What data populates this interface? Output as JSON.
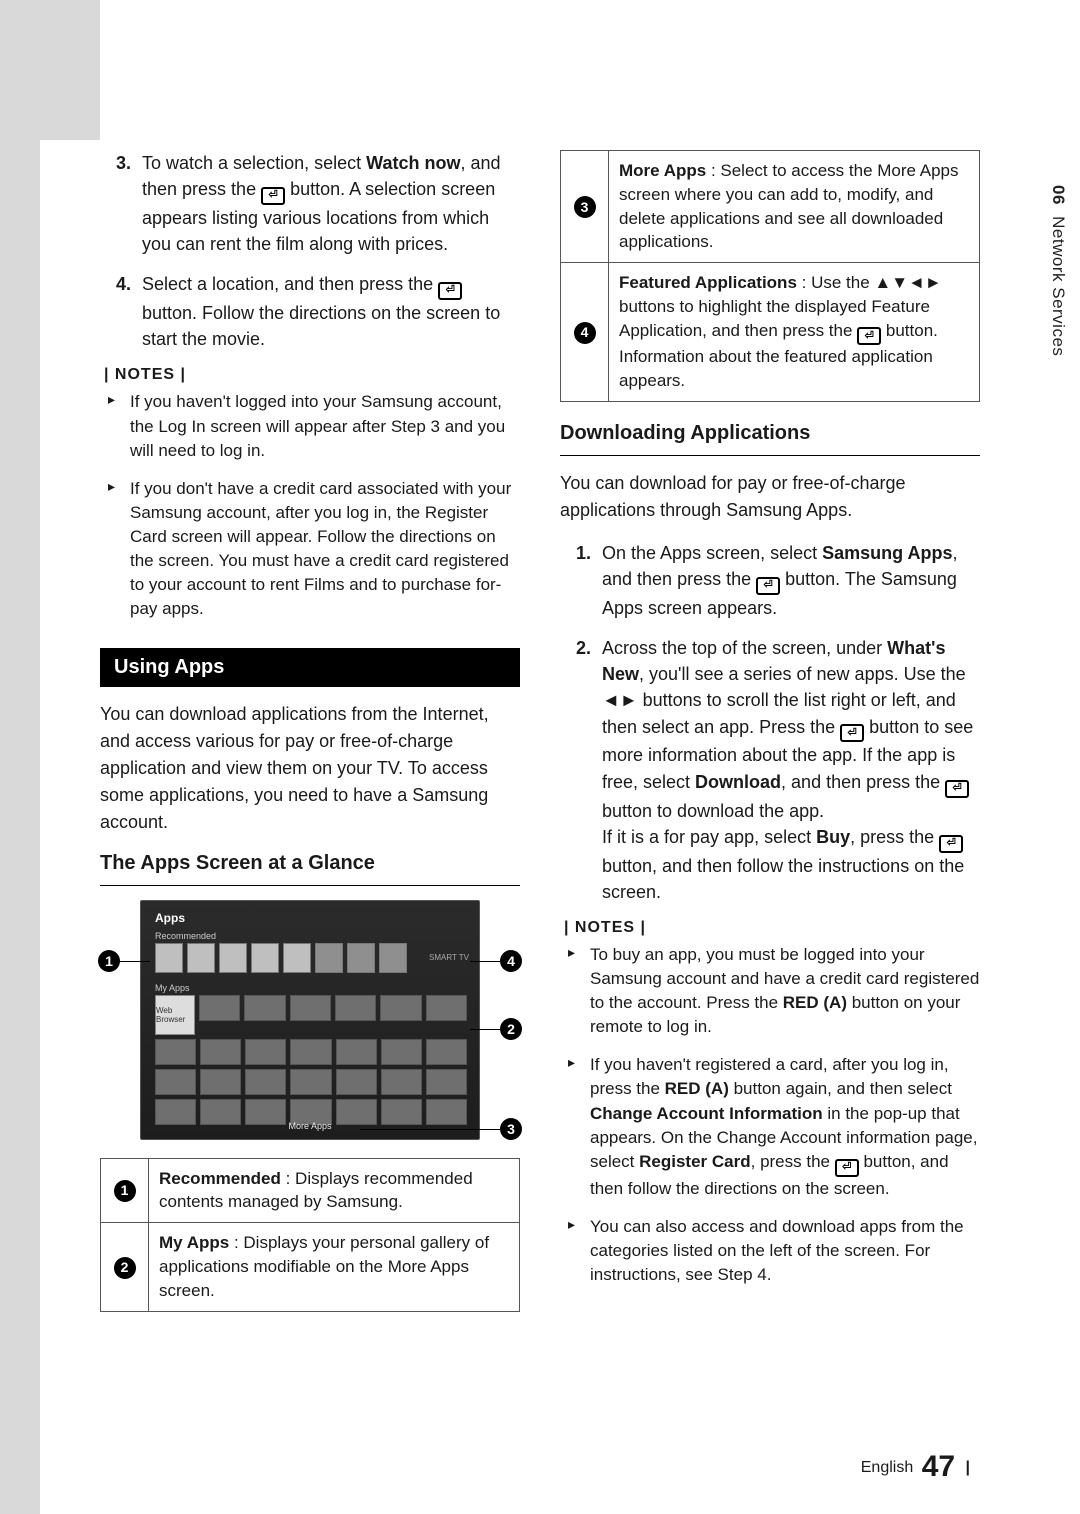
{
  "side": {
    "chapter_num": "06",
    "chapter_title": "Network Services"
  },
  "left": {
    "step3_a": "To watch a selection, select ",
    "step3_bold": "Watch now",
    "step3_b": ", and then press the ",
    "step3_c": " button. A selection screen appears listing various locations from which you can rent the film along with prices.",
    "step4_a": "Select a location, and then press the ",
    "step4_b": " button. Follow the directions on the screen to start the movie.",
    "notes_hdr": "| NOTES |",
    "note1": "If you haven't logged into your Samsung account, the Log In screen will appear after Step 3 and you will need to log in.",
    "note2": "If you don't have a credit card associated with your Samsung account, after you log in, the Register Card screen will appear. Follow the directions on the screen. You must have a credit card registered to your account to rent Films and to purchase for-pay apps.",
    "section": "Using Apps",
    "using_para": "You can download applications from the Internet, and access various for pay or free-of-charge application and view them on your TV. To access some applications, you need to have a Samsung account.",
    "sub_h": "The Apps Screen at a Glance",
    "diagram": {
      "apps": "Apps",
      "recommended": "Recommended",
      "myapps": "My Apps",
      "webbrowser": "Web Browser",
      "moreapps": "More Apps",
      "smart": "SMART TV"
    },
    "t1_a": "Recommended",
    "t1_b": " : Displays recommended contents managed by Samsung.",
    "t2_a": "My Apps",
    "t2_b": " : Displays your personal gallery of applications modifiable on the More Apps screen."
  },
  "right": {
    "t3_a": "More Apps",
    "t3_b": " : Select to access the More Apps screen where you can add to, modify, and delete applications and see all downloaded applications.",
    "t4_a": "Featured Applications",
    "t4_b": " : Use the ▲▼◄► buttons to highlight the displayed Feature Application, and then press the ",
    "t4_c": " button. Information about the featured application appears.",
    "sub_h": "Downloading Applications",
    "dl_para": "You can download for pay or free-of-charge applications through Samsung Apps.",
    "s1_a": "On the Apps screen, select ",
    "s1_bold": "Samsung Apps",
    "s1_b": ", and then press the ",
    "s1_c": " button. The Samsung Apps screen appears.",
    "s2_a": "Across the top of the screen, under ",
    "s2_bold1": "What's New",
    "s2_b": ", you'll see a series of new apps. Use the ◄► buttons to scroll the list right or left, and then select an app. Press the ",
    "s2_c": " button to see more information about the app. If the app is free, select ",
    "s2_bold2": "Download",
    "s2_d": ", and then press the ",
    "s2_e": " button to download the app.",
    "s2_f": "If it is a for pay app, select ",
    "s2_bold3": "Buy",
    "s2_g": ", press the ",
    "s2_h": " button, and then follow the instructions on the screen.",
    "notes_hdr": "| NOTES |",
    "n1_a": "To buy an app, you must be logged into your Samsung account and have a credit card registered to the account. Press the ",
    "n1_bold": "RED (A)",
    "n1_b": " button on your remote to log in.",
    "n2_a": "If you haven't registered a card, after you log in, press the ",
    "n2_bold1": "RED (A)",
    "n2_b": " button again, and then select ",
    "n2_bold2": "Change Account Information",
    "n2_c": " in the pop-up that appears. On the Change Account information page, select ",
    "n2_bold3": "Register Card",
    "n2_d": ", press the ",
    "n2_e": " button, and then follow the directions on the screen.",
    "n3": "You can also access and download apps from the categories listed on the left of the screen. For instructions, see Step 4."
  },
  "pager": {
    "lang": "English",
    "page": "47"
  }
}
